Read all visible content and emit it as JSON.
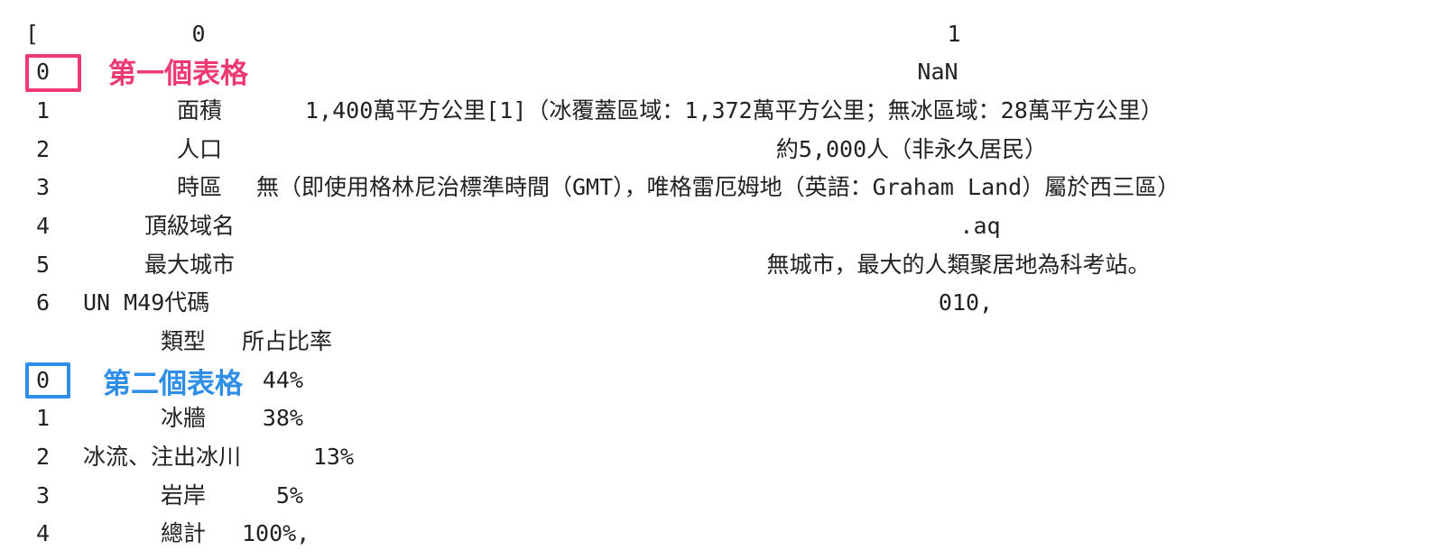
{
  "output": {
    "open_bracket": "[",
    "table1": {
      "col_headers": [
        "0",
        "1"
      ],
      "rows": [
        {
          "index": "0",
          "col0": "",
          "col1": "NaN"
        },
        {
          "index": "1",
          "col0": "面積",
          "col1": "1,400萬平方公里[1]（冰覆蓋區域：1,372萬平方公里；無冰區域：28萬平方公里）"
        },
        {
          "index": "2",
          "col0": "人口",
          "col1": "約5,000人（非永久居民）"
        },
        {
          "index": "3",
          "col0": "時區",
          "col1": "無（即使用格林尼治標準時間（GMT），唯格雷厄姆地（英語：Graham Land）屬於西三區）"
        },
        {
          "index": "4",
          "col0": "頂級域名",
          "col1": ".aq"
        },
        {
          "index": "5",
          "col0": "最大城市",
          "col1": "無城市，最大的人類聚居地為科考站。"
        },
        {
          "index": "6",
          "col0": "UN M49代碼",
          "col1": "010,"
        }
      ]
    },
    "table2": {
      "col_headers": [
        "類型",
        "所占比率"
      ],
      "rows": [
        {
          "index": "0",
          "col0": "",
          "col1": "44%"
        },
        {
          "index": "1",
          "col0": "冰牆",
          "col1": "38%"
        },
        {
          "index": "2",
          "col0": "冰流、注出冰川",
          "col1": "13%"
        },
        {
          "index": "3",
          "col0": "岩岸",
          "col1": "5%"
        },
        {
          "index": "4",
          "col0": "總計",
          "col1": "100%,"
        }
      ]
    }
  },
  "annotations": {
    "first_table": {
      "label": "第一個表格",
      "color": "#ee3a73"
    },
    "second_table": {
      "label": "第二個表格",
      "color": "#2f8ee8"
    }
  }
}
